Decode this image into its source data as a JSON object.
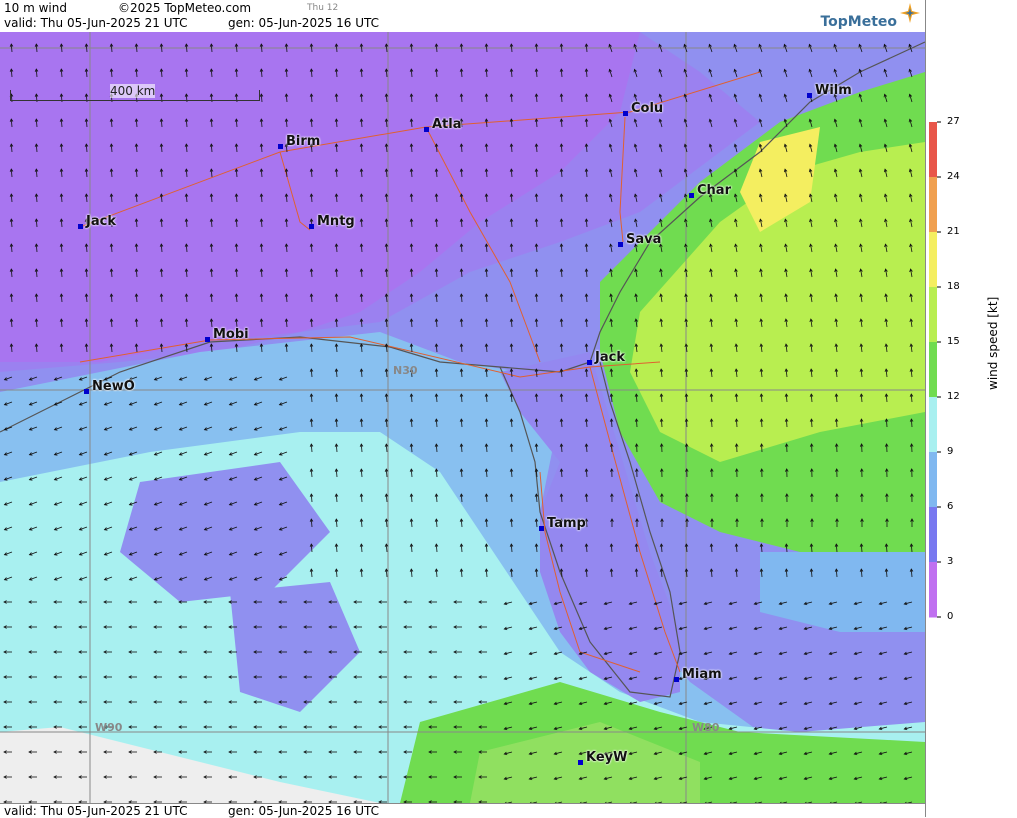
{
  "header": {
    "product": "10 m wind",
    "copyright": "©2025 TopMeteo.com",
    "day": "Thu 12",
    "valid": "valid:  Thu  05-Jun-2025  21 UTC",
    "gen": "gen: 05-Jun-2025 16 UTC",
    "logo": "TopMeteo"
  },
  "footer": {
    "valid": "valid:  Thu  05-Jun-2025  21 UTC",
    "gen": "gen: 05-Jun-2025 16 UTC"
  },
  "scale": {
    "label": "400 km"
  },
  "grid_labels": {
    "n30": "N30",
    "w90": "W90",
    "w80": "W80"
  },
  "cities": [
    {
      "name": "Jack",
      "id": "jackson"
    },
    {
      "name": "Birm",
      "id": "birmingham"
    },
    {
      "name": "Atla",
      "id": "atlanta"
    },
    {
      "name": "Colu",
      "id": "columbia"
    },
    {
      "name": "Wilm",
      "id": "wilmington"
    },
    {
      "name": "Char",
      "id": "charleston"
    },
    {
      "name": "Mntg",
      "id": "montgomery"
    },
    {
      "name": "Sava",
      "id": "savannah"
    },
    {
      "name": "Mobi",
      "id": "mobile"
    },
    {
      "name": "Jack",
      "id": "jacksonville"
    },
    {
      "name": "NewO",
      "id": "neworleans"
    },
    {
      "name": "Tamp",
      "id": "tampa"
    },
    {
      "name": "Miam",
      "id": "miami"
    },
    {
      "name": "KeyW",
      "id": "keywest"
    }
  ],
  "legend": {
    "title": "wind speed [kt]",
    "ticks": [
      "27",
      "24",
      "21",
      "18",
      "15",
      "12",
      "9",
      "6",
      "3",
      "0"
    ],
    "colors": [
      "#e8564a",
      "#f0a050",
      "#f4ee60",
      "#b8ee50",
      "#70dc50",
      "#a8f0f0",
      "#80b8f0",
      "#7878f0",
      "#c070f0"
    ]
  }
}
